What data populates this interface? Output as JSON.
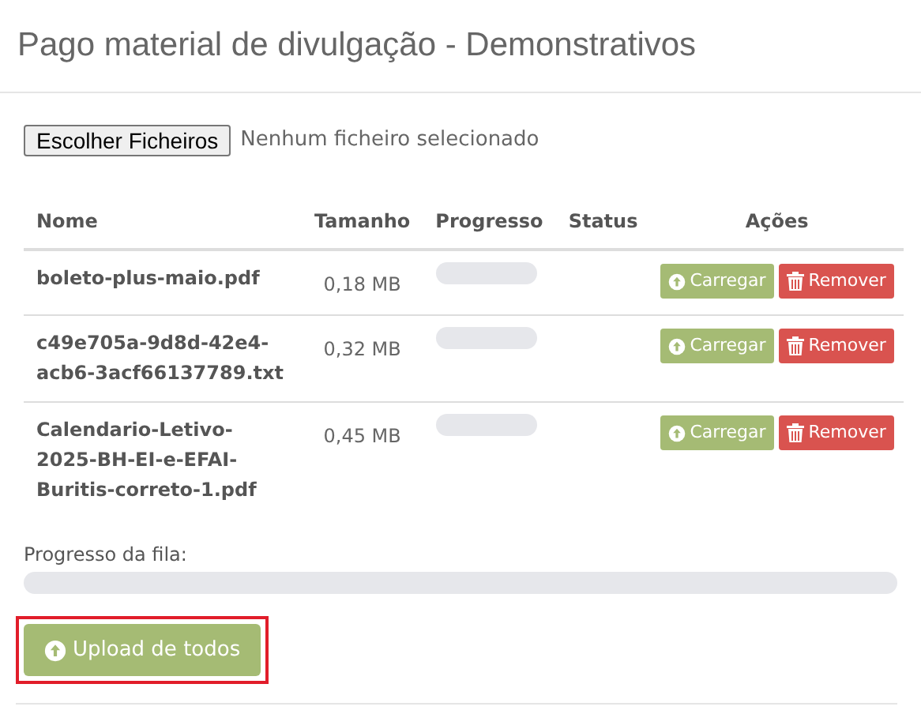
{
  "title": "Pago material de divulgação - Demonstrativos",
  "file_input": {
    "button": "Escolher Ficheiros",
    "status": "Nenhum ficheiro selecionado"
  },
  "table": {
    "columns": [
      "Nome",
      "Tamanho",
      "Progresso",
      "Status",
      "Ações"
    ],
    "rows": [
      {
        "name": "boleto-plus-maio.pdf",
        "size": "0,18 MB",
        "level": 0,
        "upload": "Carregar",
        "remove": "Remover"
      },
      {
        "name": "c49e705a-9d8d-42e4-acb6-3acf66137789.txt",
        "size": "0,32 MB",
        "level": 0,
        "upload": "Carregar",
        "remove": "Remover"
      },
      {
        "name": "Calendario-Letivo-2025-BH-EI-e-EFAI-Buritis-correto-1.pdf",
        "size": "0,45 MB",
        "level": 0,
        "upload": "Carregar",
        "remove": "Remover"
      }
    ]
  },
  "queue": {
    "label": "Progresso da fila:",
    "level": 0
  },
  "upload_all": {
    "label": "Upload de todos",
    "highlighted": true
  }
}
